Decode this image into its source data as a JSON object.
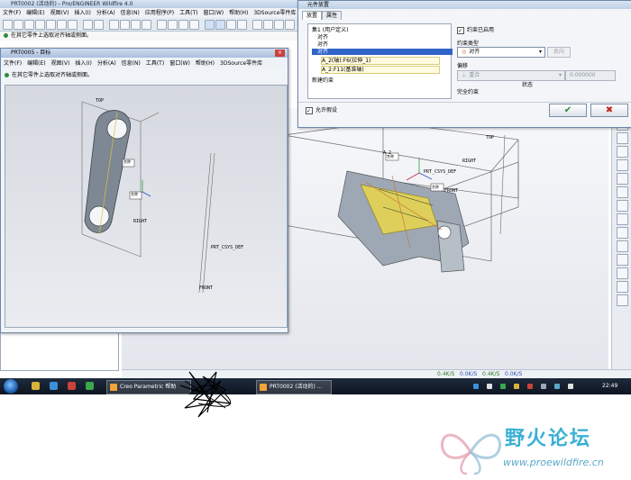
{
  "main_window": {
    "title": "PRT0002 (活动的) - Pro/ENGINEER Wildfire 4.0",
    "menu": [
      "文件(F)",
      "编辑(E)",
      "视图(V)",
      "插入(I)",
      "分析(A)",
      "信息(N)",
      "应用程序(P)",
      "工具(T)",
      "窗口(W)",
      "帮助(H)",
      "3DSource零件库"
    ],
    "message": "在其它零件上选取对齐轴或侧面。",
    "status_rates": [
      "0.4K/S",
      "0.0K/S",
      "0.4K/S",
      "0.0K/S"
    ]
  },
  "assembly_window": {
    "title": "PRT0005 - 目标",
    "menu": [
      "文件(F)",
      "编辑(E)",
      "视图(V)",
      "插入(I)",
      "分析(A)",
      "信息(N)",
      "工具(T)",
      "窗口(W)",
      "帮助(H)",
      "3DSource零件库"
    ],
    "message": "在其它零件上选取对齐轴或侧面。",
    "labels": {
      "csys": "PRT_CSYS_DEF",
      "top": "TOP",
      "front": "FRONT",
      "right": "RIGHT",
      "tag1": "名称",
      "tag2": "名称"
    }
  },
  "main_viewport_labels": {
    "csys": "PRT_CSYS_DEF",
    "top": "TOP",
    "front": "FRONT",
    "right": "RIGHT",
    "axis": "A_2",
    "tag1": "名称",
    "tag2": "名称"
  },
  "dialog": {
    "title": "元件放置",
    "tabs": [
      "放置",
      "属性"
    ],
    "tree": {
      "root": "集1 (用户定义)",
      "items": [
        "对齐",
        "对齐",
        "对齐"
      ],
      "refs": [
        "A_2(轴):F6(拉伸_1)",
        "A_2:F11(基准轴)"
      ],
      "new_constraint": "新建约束"
    },
    "constraint_enabled_label": "约束已启用",
    "constraint_type_label": "约束类型",
    "constraint_type_value": "对齐",
    "flip_label": "反向",
    "offset_label": "偏移",
    "offset_value": "重合",
    "offset_number": "0.000000",
    "status_label": "状态",
    "status_value": "完全约束",
    "option_label": "允许假设",
    "ok_symbol": "✔",
    "cancel_symbol": "✖"
  },
  "taskbar": {
    "tasks": [
      "Creo Parametric 帮助",
      "PRT0002 (活动的) ..."
    ],
    "clock": "22:49"
  },
  "watermark": {
    "forum_name": "野火论坛",
    "forum_url": "www.proewildfire.cn"
  },
  "colors": {
    "select_blue": "#2f64c8",
    "ok_green": "#1f8a2f",
    "cancel_red": "#c4271e",
    "model_yellow": "#e8d64a",
    "datum_orange": "#c9703a"
  }
}
